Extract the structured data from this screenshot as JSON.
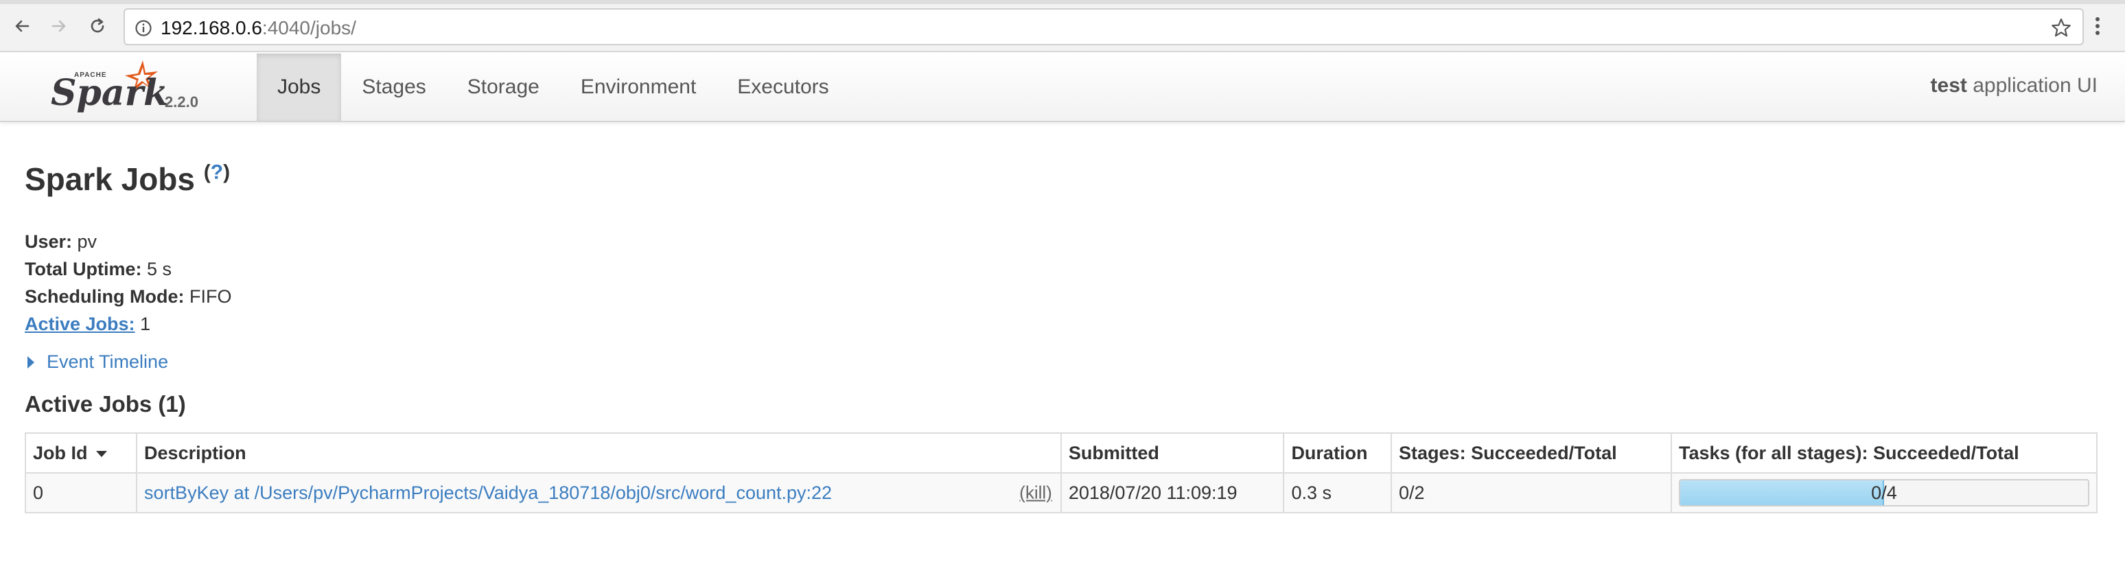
{
  "browser": {
    "url_host": "192.168.0.6",
    "url_path": ":4040/jobs/"
  },
  "navbar": {
    "brand_apache": "APACHE",
    "brand_name": "Spark",
    "version": "2.2.0",
    "tabs": [
      {
        "label": "Jobs",
        "active": true
      },
      {
        "label": "Stages",
        "active": false
      },
      {
        "label": "Storage",
        "active": false
      },
      {
        "label": "Environment",
        "active": false
      },
      {
        "label": "Executors",
        "active": false
      }
    ],
    "app_name_bold": "test",
    "app_name_rest": " application UI"
  },
  "page": {
    "title": "Spark Jobs",
    "help_open": "(",
    "help_link": "?",
    "help_close": ")"
  },
  "summary": {
    "user_label": "User:",
    "user_value": " pv",
    "uptime_label": "Total Uptime:",
    "uptime_value": " 5 s",
    "mode_label": "Scheduling Mode:",
    "mode_value": " FIFO",
    "active_label": "Active Jobs:",
    "active_value": " 1"
  },
  "timeline": {
    "label": "Event Timeline"
  },
  "active_jobs": {
    "title": "Active Jobs (1)",
    "columns": {
      "job_id": "Job Id",
      "description": "Description",
      "submitted": "Submitted",
      "duration": "Duration",
      "stages": "Stages: Succeeded/Total",
      "tasks": "Tasks (for all stages): Succeeded/Total"
    },
    "rows": [
      {
        "job_id": "0",
        "description": "sortByKey at /Users/pv/PycharmProjects/Vaidya_180718/obj0/src/word_count.py:22",
        "kill": "(kill)",
        "submitted": "2018/07/20 11:09:19",
        "duration": "0.3 s",
        "stages": "0/2",
        "tasks_label": "0/4",
        "tasks_running_fraction": 0.5
      }
    ]
  },
  "colors": {
    "link": "#3b7dc0",
    "progress_fill": "#a6d9f3"
  }
}
